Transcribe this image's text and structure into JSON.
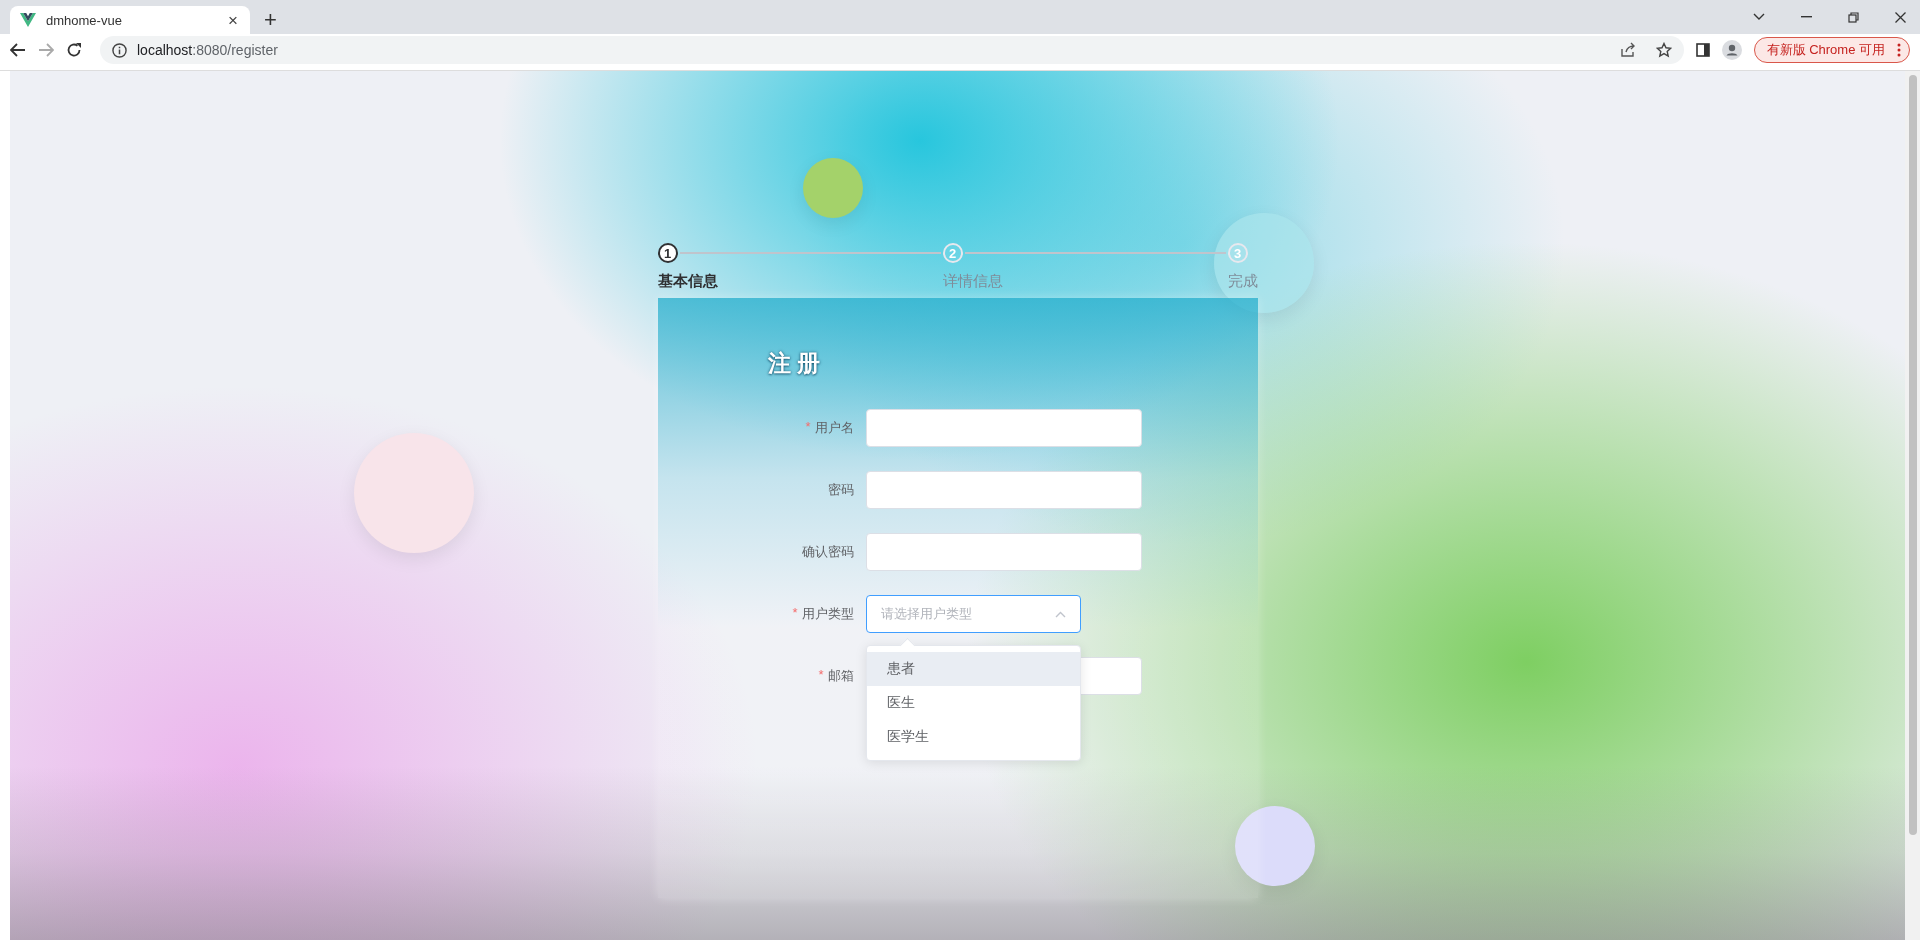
{
  "browser": {
    "tab_title": "dmhome-vue",
    "tab_close": "×",
    "new_tab": "+",
    "url_host": "localhost",
    "url_rest": ":8080/register",
    "update_button": "有新版 Chrome 可用"
  },
  "steps": [
    {
      "number": "1",
      "label": "基本信息",
      "selected": true
    },
    {
      "number": "2",
      "label": "详情信息",
      "selected": false
    },
    {
      "number": "3",
      "label": "完成",
      "selected": false
    }
  ],
  "form": {
    "title": "注册",
    "required_mark": "*",
    "fields": [
      {
        "kind": "input",
        "label": "用户名",
        "required": true
      },
      {
        "kind": "input",
        "label": "密码",
        "required": false
      },
      {
        "kind": "input",
        "label": "确认密码",
        "required": false
      },
      {
        "kind": "select",
        "label": "用户类型",
        "required": true,
        "placeholder": "请选择用户类型",
        "expanded": true,
        "options": [
          {
            "label": "患者",
            "selected": false,
            "hovered": true
          },
          {
            "label": "医生",
            "selected": false,
            "hovered": false
          },
          {
            "label": "医学生",
            "selected": false,
            "hovered": false
          }
        ]
      },
      {
        "kind": "input",
        "label": "邮箱",
        "required": true
      }
    ]
  }
}
